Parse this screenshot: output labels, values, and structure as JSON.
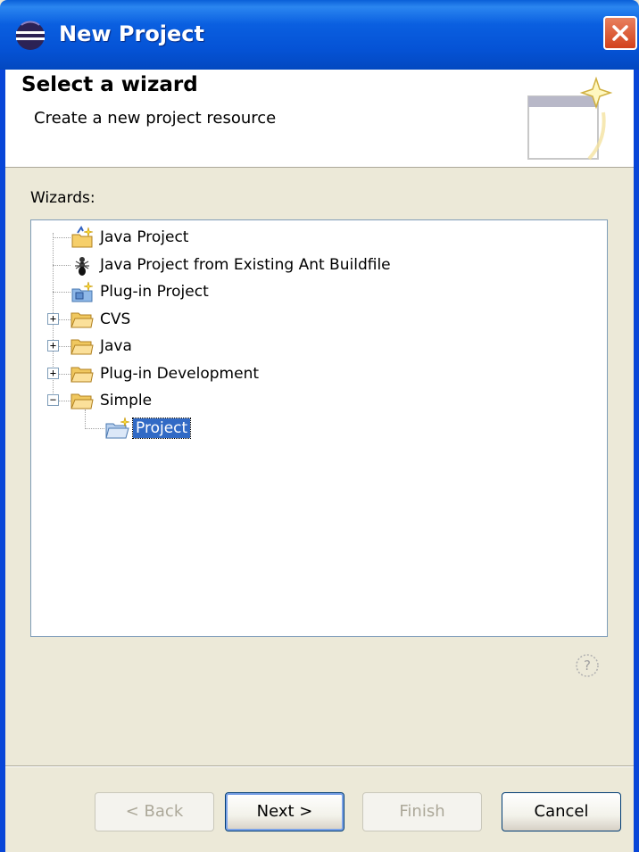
{
  "window": {
    "title": "New Project"
  },
  "header": {
    "title": "Select a wizard",
    "description": "Create a new project resource"
  },
  "wizards": {
    "label": "Wizards:",
    "items": [
      {
        "label": "Java Project",
        "icon": "java-project-icon"
      },
      {
        "label": "Java Project from Existing Ant Buildfile",
        "icon": "ant-icon"
      },
      {
        "label": "Plug-in Project",
        "icon": "plugin-project-icon"
      },
      {
        "label": "CVS",
        "icon": "folder-icon",
        "expander": "+"
      },
      {
        "label": "Java",
        "icon": "folder-icon",
        "expander": "+"
      },
      {
        "label": "Plug-in Development",
        "icon": "folder-icon",
        "expander": "+"
      },
      {
        "label": "Simple",
        "icon": "folder-open-icon",
        "expander": "-"
      },
      {
        "label": "Project",
        "icon": "new-project-icon",
        "selected": true
      }
    ]
  },
  "buttons": {
    "back": "< Back",
    "next": "Next >",
    "finish": "Finish",
    "cancel": "Cancel"
  },
  "colors": {
    "titlebar": "#0553d6",
    "selection": "#316ac5",
    "dialog_bg": "#ECE9D8"
  }
}
